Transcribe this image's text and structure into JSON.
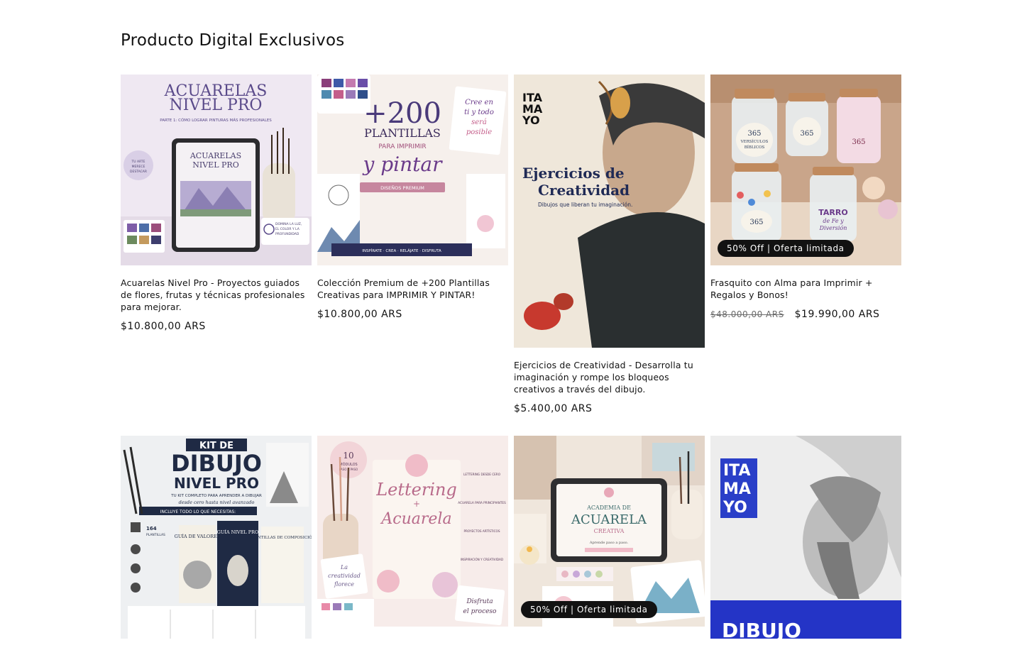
{
  "section": {
    "title": "Producto Digital Exclusivos"
  },
  "products": [
    {
      "title": "Acuarelas Nivel Pro - Proyectos guiados de flores, frutas y técnicas profesionales para mejorar.",
      "price": "$10.800,00 ARS",
      "image": {
        "heading1": "ACUARELAS",
        "heading2": "NIVEL PRO",
        "subtitle": "PARTE 1: CÓMO LOGRAR PINTURAS MÁS PROFESIONALES",
        "tablet1": "ACUARELAS",
        "tablet2": "NIVEL PRO",
        "seal1": "TU ARTE",
        "seal2": "MERECE",
        "seal3": "DESTACAR",
        "note1": "DOMINA LA LUZ,",
        "note2": "EL COLOR Y LA",
        "note3": "PROFUNDIDAD"
      }
    },
    {
      "title": "Colección Premium de +200 Plantillas Creativas para IMPRIMIR Y PINTAR!",
      "price": "$10.800,00 ARS",
      "image": {
        "big": "+200",
        "line1": "PLANTILLAS",
        "line2": "PARA IMPRIMIR",
        "script": "y pintar",
        "ribbon": "DISEÑOS PREMIUM",
        "tag1": "Cree en",
        "tag2": "ti y todo",
        "tag3": "será",
        "tag4": "posible",
        "footer": "INSPÍRATE · CREA · RELÁJATE · DISFRUTA"
      }
    },
    {
      "title": "Ejercicios de Creatividad - Desarrolla tu imaginación y rompe los bloqueos creativos a través del dibujo.",
      "price": "$5.400,00 ARS",
      "image": {
        "logo1": "ITA",
        "logo2": "MA",
        "logo3": "YO",
        "head1": "Ejercicios de",
        "head2": "Creatividad",
        "sub": "Dibujos que liberan tu imaginación."
      }
    },
    {
      "title": "Frasquito con Alma para Imprimir + Regalos y Bonos!",
      "price_old": "$48.000,00 ARS",
      "price": "$19.990,00 ARS",
      "badge": "50% Off | Oferta limitada",
      "image": {
        "jar1a": "365",
        "jar1b": "VERSÍCULOS",
        "jar1c": "BÍBLICOS",
        "jar2": "365",
        "jar3": "365",
        "jar4": "365",
        "jar5a": "TARRO",
        "jar5b": "de Fe y",
        "jar5c": "Diversión"
      }
    },
    {
      "title": "",
      "price": "",
      "image": {
        "kit": "KIT DE",
        "big1": "DIBUJO",
        "big2": "NIVEL PRO",
        "sub1": "TU KIT COMPLETO PARA APRENDER A DIBUJAR",
        "sub2": "desde cero hasta nivel avanzado",
        "includes": "INCLUYE TODO LO QUE NECESITAS:",
        "b1": "GUÍA DE VALORES",
        "b2": "GUÍA NIVEL PRO",
        "b3": "PLANTILLAS DE COMPOSICIÓN",
        "count": "164",
        "countlabel": "PLANTILLAS"
      }
    },
    {
      "title": "",
      "price": "",
      "image": {
        "mod1": "10",
        "mod2": "MÓDULOS",
        "mod3": "PASO A PASO",
        "script1": "Lettering",
        "script2": "+",
        "script3": "Acuarela",
        "side1": "LETTERING DESDE CERO",
        "side2": "ACUARELA PARA PRINCIPIANTES",
        "side3": "PROYECTOS ARTÍSTICOS",
        "side4": "INSPIRACIÓN Y CREATIVIDAD",
        "note1": "La",
        "note2": "creatividad",
        "note3": "florece",
        "note4": "Disfruta",
        "note5": "el proceso"
      }
    },
    {
      "title": "",
      "price": "",
      "badge": "50% Off | Oferta limitada",
      "image": {
        "t1": "ACADEMIA DE",
        "t2": "ACUARELA",
        "t3": "CREATIVA",
        "t4": "Aprende paso a paso."
      }
    },
    {
      "title": "",
      "price": "",
      "image": {
        "logo1": "ITA",
        "logo2": "MA",
        "logo3": "YO",
        "banner": "DIBUJO"
      }
    }
  ],
  "colors": {
    "accent_purple": "#5a4a8a",
    "badge_bg": "#121212",
    "logo_blue": "#2a3fc8"
  }
}
